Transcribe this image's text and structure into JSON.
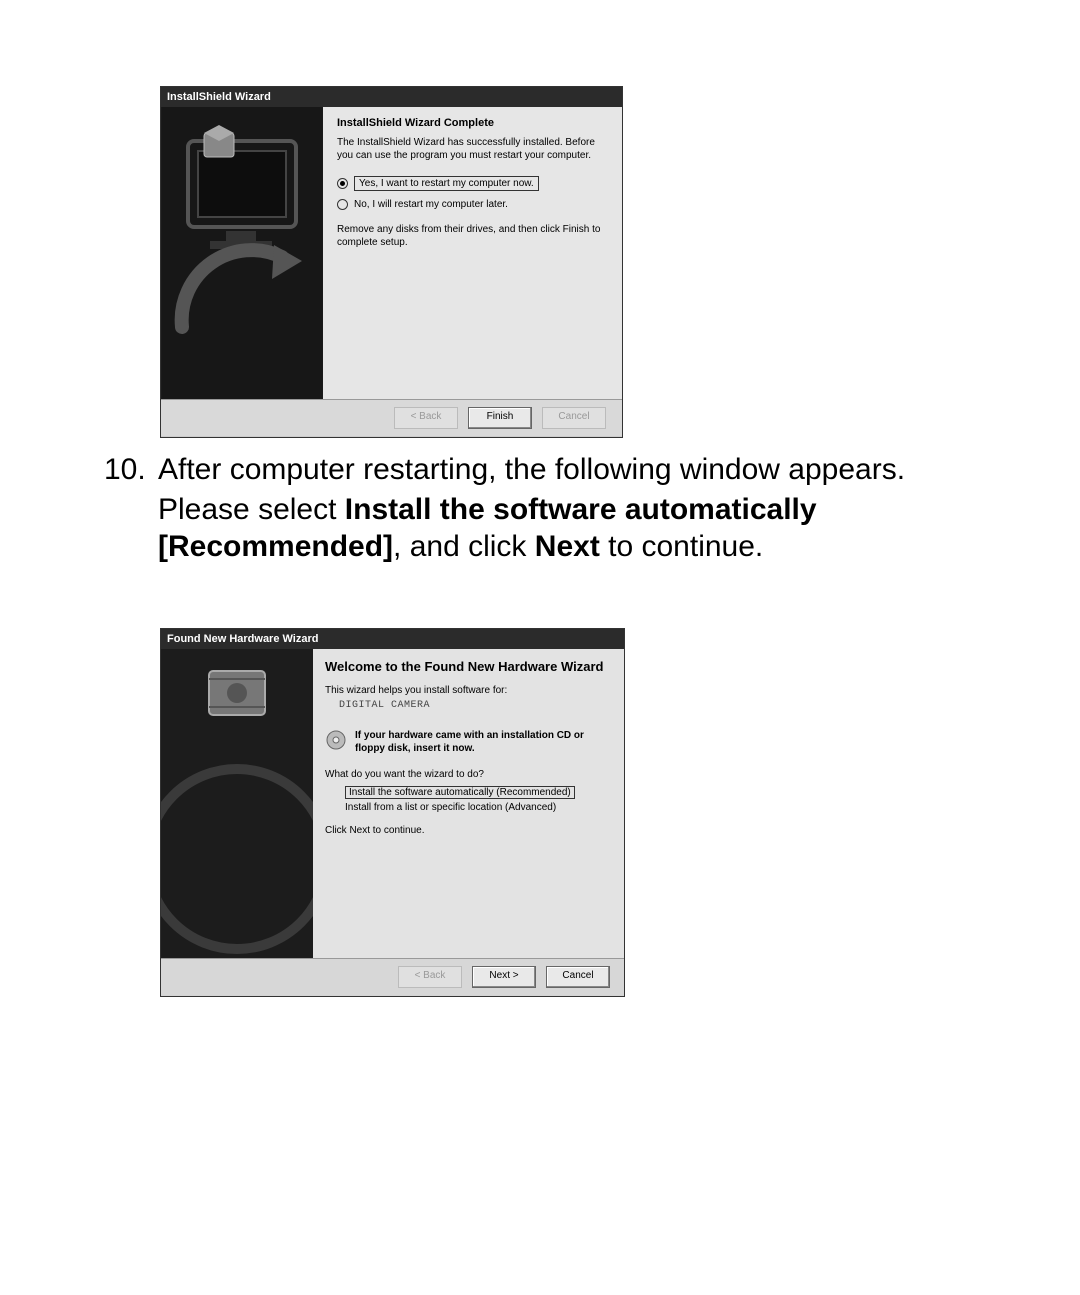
{
  "instruction": {
    "number": "10.",
    "line1": "After computer restarting, the following window appears.",
    "line2a": "Please select ",
    "line2b_bold": "Install the software automatically [Recommended]",
    "line2c": ", and click ",
    "line2d_bold": "Next",
    "line2e": " to continue."
  },
  "dialog1": {
    "title": "InstallShield Wizard",
    "heading": "InstallShield Wizard Complete",
    "paragraph": "The InstallShield Wizard has successfully installed. Before you can use the program you must restart your computer.",
    "radio_yes": "Yes, I want to restart my computer now.",
    "radio_no": "No, I will restart my computer later.",
    "note": "Remove any disks from their drives, and then click Finish to complete setup.",
    "btn_back": "< Back",
    "btn_finish": "Finish",
    "btn_cancel": "Cancel"
  },
  "dialog2": {
    "title": "Found New Hardware Wizard",
    "heading": "Welcome to the Found New Hardware Wizard",
    "sub": "This wizard helps you install software for:",
    "device": "DIGITAL CAMERA",
    "cd_text": "If your hardware came with an installation CD or floppy disk, insert it now.",
    "question": "What do you want the wizard to do?",
    "radio_auto": "Install the software automatically (Recommended)",
    "radio_adv": "Install from a list or specific location (Advanced)",
    "continue": "Click Next to continue.",
    "btn_back": "< Back",
    "btn_next": "Next >",
    "btn_cancel": "Cancel"
  }
}
